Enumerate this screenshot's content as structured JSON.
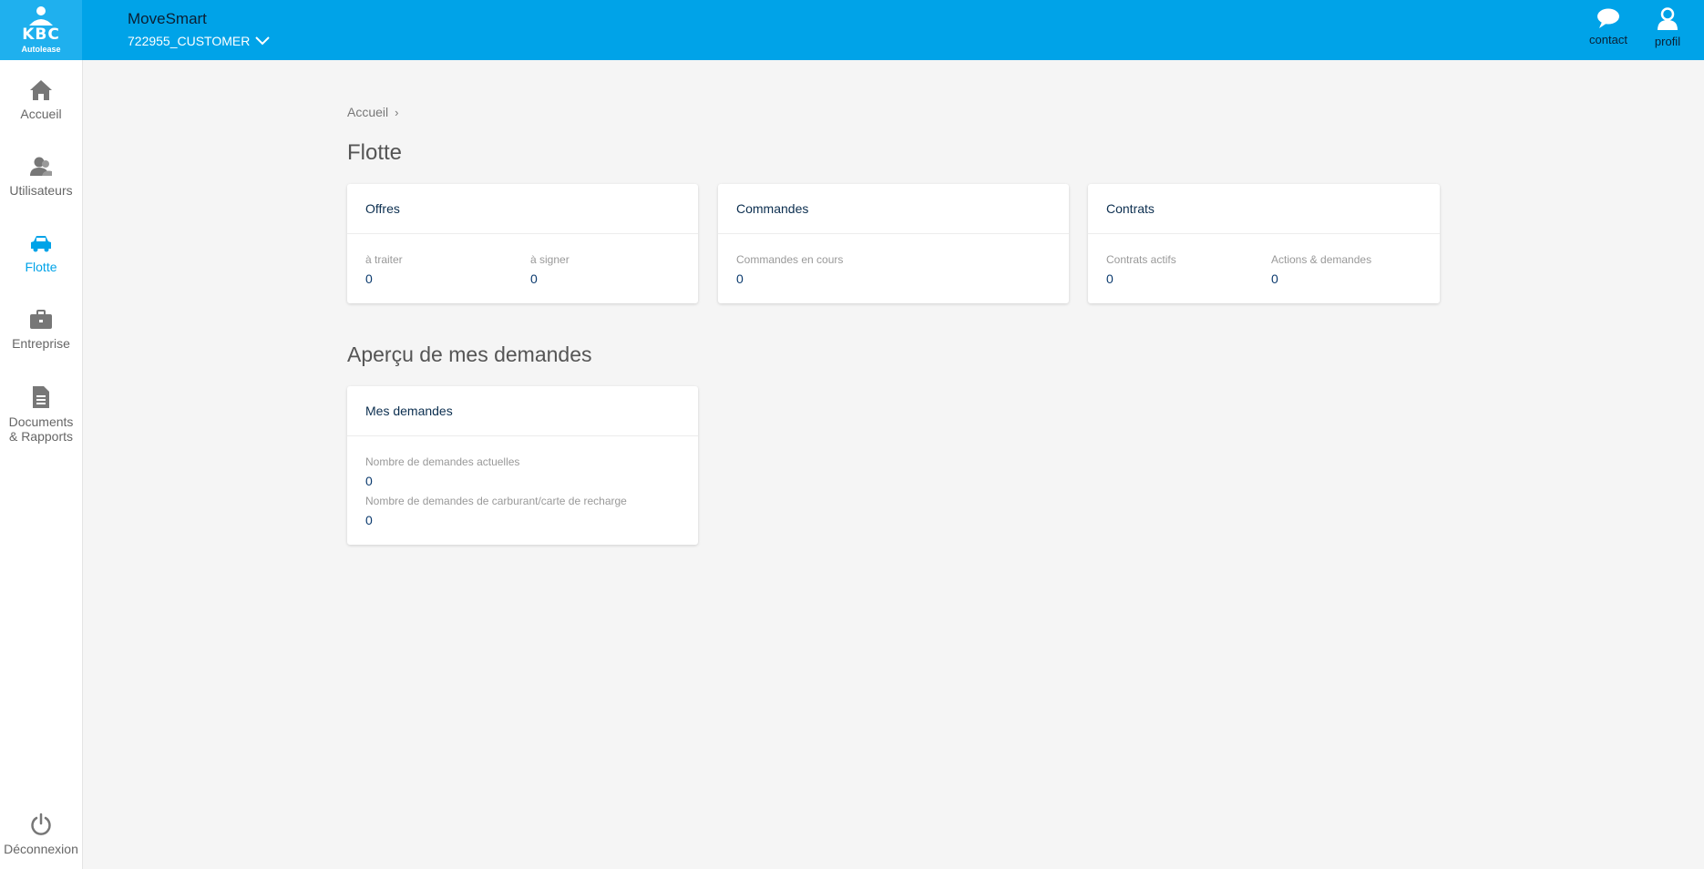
{
  "header": {
    "logo_text": "KBC",
    "logo_sub": "Autolease",
    "app_title": "MoveSmart",
    "customer": "722955_CUSTOMER",
    "contact_label": "contact",
    "profile_label": "profil"
  },
  "sidebar": {
    "items": [
      {
        "label": "Accueil",
        "icon": "home-icon"
      },
      {
        "label": "Utilisateurs",
        "icon": "users-icon"
      },
      {
        "label": "Flotte",
        "icon": "car-icon"
      },
      {
        "label": "Entreprise",
        "icon": "briefcase-icon"
      },
      {
        "label": "Documents",
        "label2": "& Rapports",
        "icon": "document-icon"
      }
    ],
    "logout_label": "Déconnexion"
  },
  "breadcrumb": {
    "home": "Accueil",
    "sep": "›"
  },
  "page_title": "Flotte",
  "cards": {
    "offres": {
      "title": "Offres",
      "stat1_label": "à traiter",
      "stat1_value": "0",
      "stat2_label": "à signer",
      "stat2_value": "0"
    },
    "commandes": {
      "title": "Commandes",
      "stat1_label": "Commandes en cours",
      "stat1_value": "0"
    },
    "contrats": {
      "title": "Contrats",
      "stat1_label": "Contrats actifs",
      "stat1_value": "0",
      "stat2_label": "Actions & demandes",
      "stat2_value": "0"
    }
  },
  "section2_title": "Aperçu de mes demandes",
  "demandes": {
    "title": "Mes demandes",
    "stat1_label": "Nombre de demandes actuelles",
    "stat1_value": "0",
    "stat2_label": "Nombre de demandes de carburant/carte de recharge",
    "stat2_value": "0"
  },
  "colors": {
    "accent": "#00a3e8",
    "logo_bg": "#1fb0ee",
    "text_dark": "#0b2e4f"
  }
}
